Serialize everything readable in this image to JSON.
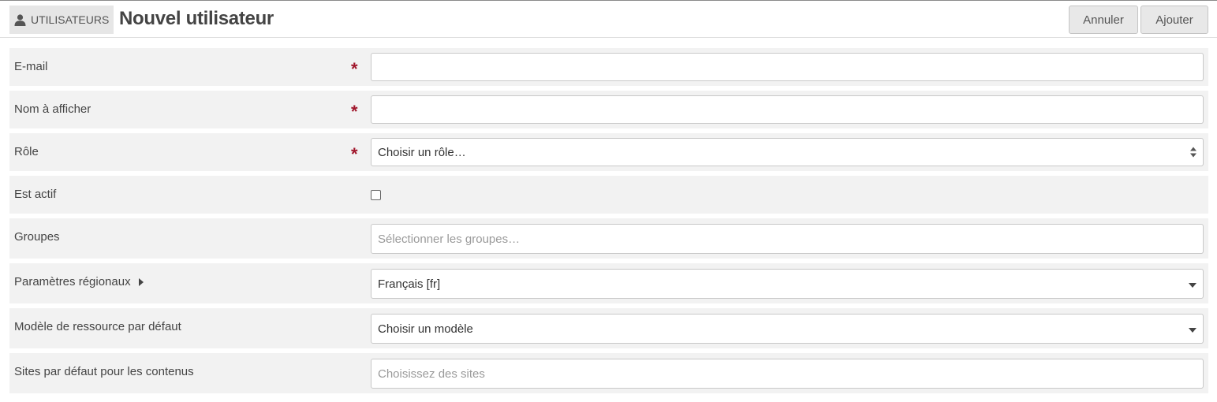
{
  "header": {
    "section_label": "UTILISATEURS",
    "section_icon": "user-icon",
    "title": "Nouvel utilisateur",
    "cancel_label": "Annuler",
    "add_label": "Ajouter"
  },
  "form": {
    "required_marker": "*",
    "email": {
      "label": "E-mail",
      "value": ""
    },
    "display_name": {
      "label": "Nom à afficher",
      "value": ""
    },
    "role": {
      "label": "Rôle",
      "selected": "Choisir un rôle…"
    },
    "is_active": {
      "label": "Est actif",
      "checked": false
    },
    "groups": {
      "label": "Groupes",
      "placeholder": "Sélectionner les groupes…"
    },
    "locale": {
      "label": "Paramètres régionaux",
      "selected": "Français [fr]"
    },
    "resource_template": {
      "label": "Modèle de ressource par défaut",
      "selected": "Choisir un modèle"
    },
    "default_sites": {
      "label": "Sites par défaut pour les contenus",
      "placeholder": "Choisissez des sites"
    }
  },
  "colors": {
    "required": "#a0162b",
    "row_background": "#f2f2f2",
    "button_background": "#e8e8e8"
  }
}
